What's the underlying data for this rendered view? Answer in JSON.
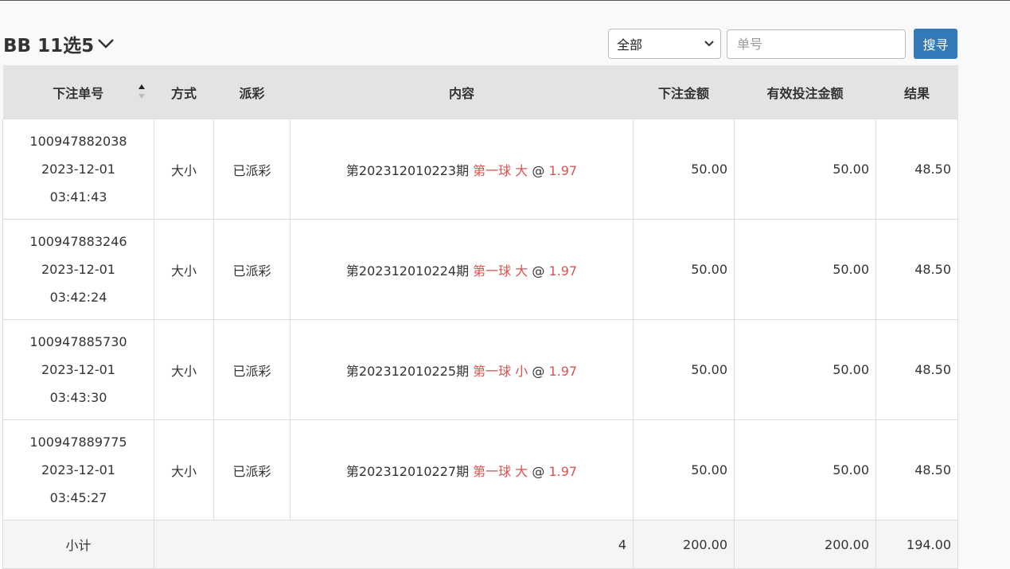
{
  "header": {
    "title": "BB 11选5",
    "filter_value": "全部",
    "search_placeholder": "单号",
    "search_button": "搜寻"
  },
  "table": {
    "columns": [
      "下注单号",
      "方式",
      "派彩",
      "内容",
      "下注金额",
      "有效投注金额",
      "结果"
    ],
    "rows": [
      {
        "order_id": "100947882038",
        "date": "2023-12-01",
        "time": "03:41:43",
        "method": "大小",
        "payout": "已派彩",
        "period": "第202312010223期",
        "bet": "第一球 大",
        "at": "@",
        "odds": "1.97",
        "amount": "50.00",
        "valid_amount": "50.00",
        "result": "48.50"
      },
      {
        "order_id": "100947883246",
        "date": "2023-12-01",
        "time": "03:42:24",
        "method": "大小",
        "payout": "已派彩",
        "period": "第202312010224期",
        "bet": "第一球 大",
        "at": "@",
        "odds": "1.97",
        "amount": "50.00",
        "valid_amount": "50.00",
        "result": "48.50"
      },
      {
        "order_id": "100947885730",
        "date": "2023-12-01",
        "time": "03:43:30",
        "method": "大小",
        "payout": "已派彩",
        "period": "第202312010225期",
        "bet": "第一球 小",
        "at": "@",
        "odds": "1.97",
        "amount": "50.00",
        "valid_amount": "50.00",
        "result": "48.50"
      },
      {
        "order_id": "100947889775",
        "date": "2023-12-01",
        "time": "03:45:27",
        "method": "大小",
        "payout": "已派彩",
        "period": "第202312010227期",
        "bet": "第一球 大",
        "at": "@",
        "odds": "1.97",
        "amount": "50.00",
        "valid_amount": "50.00",
        "result": "48.50"
      }
    ],
    "subtotal": {
      "label": "小计",
      "count": "4",
      "amount": "200.00",
      "valid_amount": "200.00",
      "result": "194.00"
    }
  },
  "colors": {
    "accent": "#337ab7",
    "odds_red": "#d9534f",
    "header_bg": "#e3e3e3"
  },
  "icons": {
    "title_dropdown": "chevron-down-icon",
    "sort": "sort-icon"
  }
}
